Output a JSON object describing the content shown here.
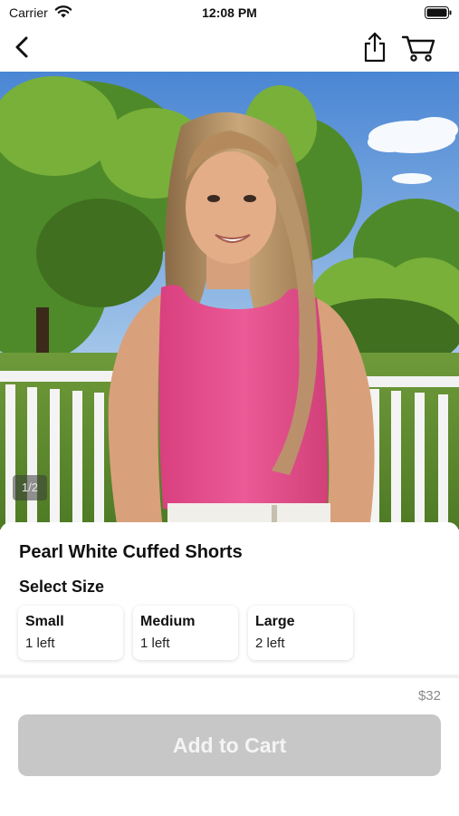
{
  "status_bar": {
    "carrier": "Carrier",
    "time": "12:08 PM",
    "icons": [
      "wifi-icon",
      "battery-icon"
    ]
  },
  "nav": {
    "icons": [
      "chevron-left-icon",
      "share-icon",
      "cart-icon"
    ]
  },
  "gallery": {
    "page_indicator": "1/2"
  },
  "product": {
    "title": "Pearl White Cuffed Shorts",
    "select_size_label": "Select Size",
    "sizes": [
      {
        "name": "Small",
        "stock": "1 left"
      },
      {
        "name": "Medium",
        "stock": "1 left"
      },
      {
        "name": "Large",
        "stock": "2 left"
      }
    ],
    "price": "$32",
    "add_to_cart_label": "Add to Cart"
  },
  "colors": {
    "button_disabled": "#c7c7c7",
    "top_pink": "#e8508f",
    "sky": "#5a93d8",
    "foliage": "#5f9a2f"
  }
}
